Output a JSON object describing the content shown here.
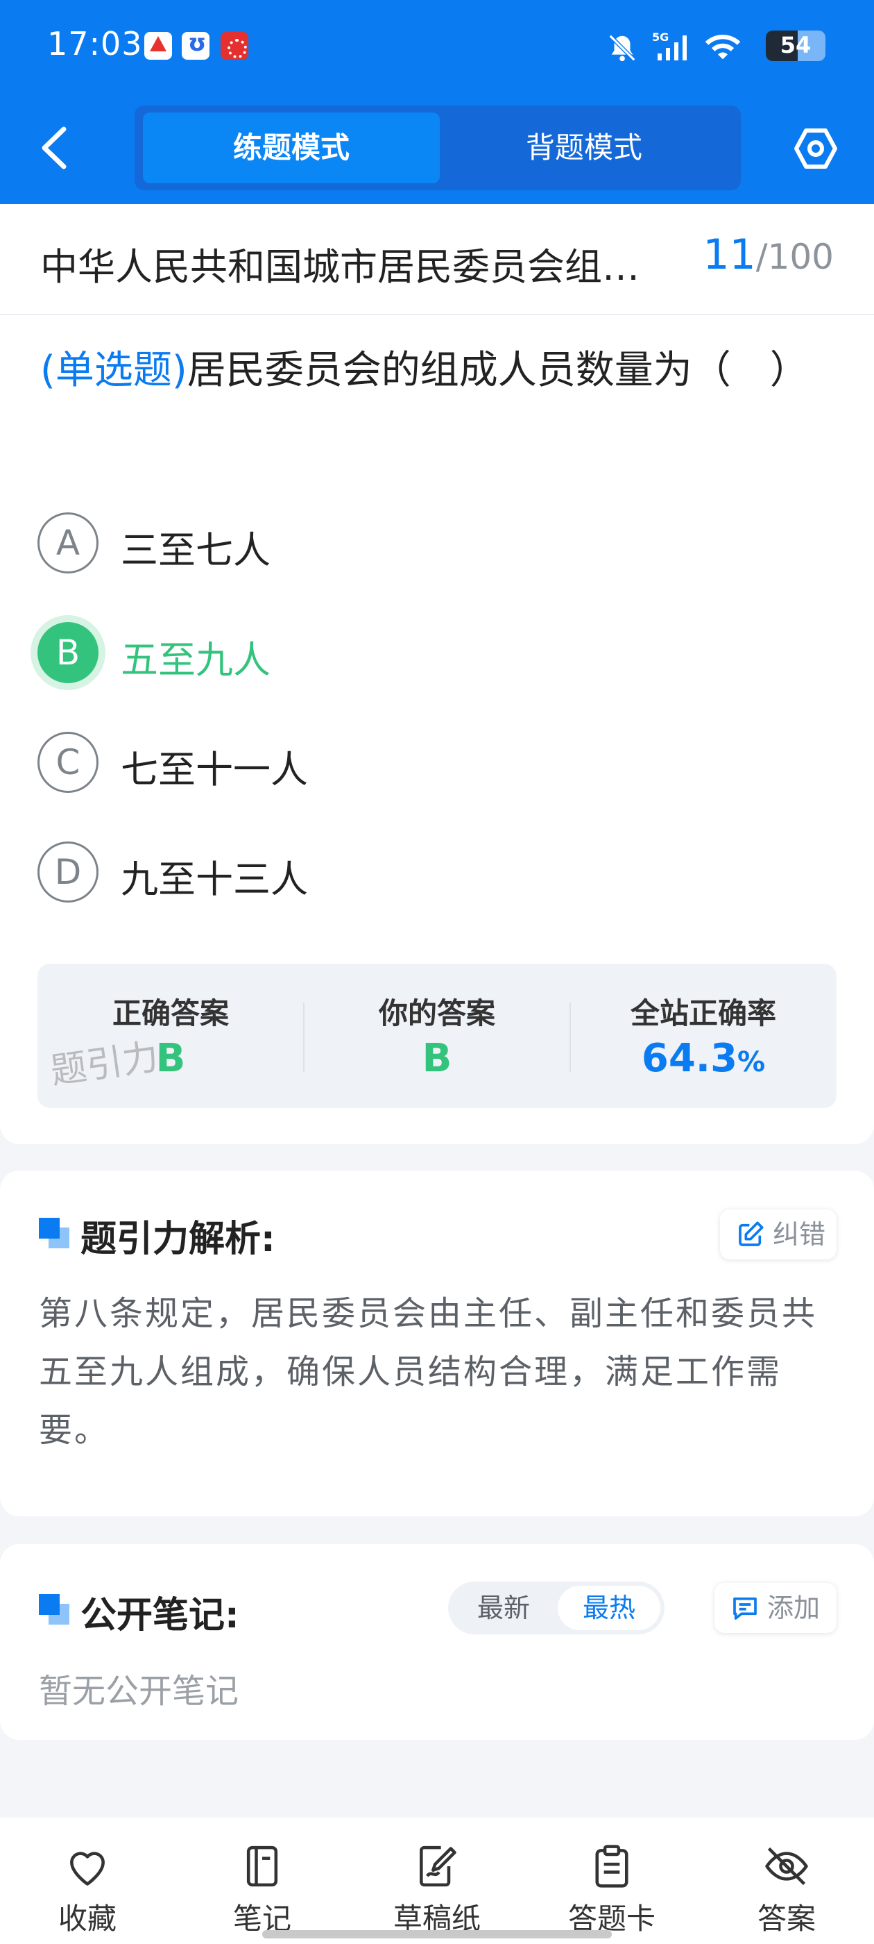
{
  "status_bar": {
    "time": "17:03",
    "battery": "54",
    "battery_level": 0.54,
    "icons": [
      "app-icon-red",
      "app-icon-blue",
      "app-icon-jigsaw",
      "bell-off-icon",
      "signal-5g-icon",
      "wifi-icon",
      "battery-icon"
    ]
  },
  "header": {
    "tabs": [
      {
        "label": "练题模式",
        "active": true
      },
      {
        "label": "背题模式",
        "active": false
      }
    ]
  },
  "title_row": {
    "title": "中华人民共和国城市居民委员会组…",
    "current": "11",
    "separator": "/",
    "total": "100"
  },
  "question": {
    "type": "(单选题)",
    "text": "居民委员会的组成人员数量为（　）",
    "options": [
      {
        "letter": "A",
        "text": "三至七人",
        "state": "normal"
      },
      {
        "letter": "B",
        "text": "五至九人",
        "state": "correct"
      },
      {
        "letter": "C",
        "text": "七至十一人",
        "state": "normal"
      },
      {
        "letter": "D",
        "text": "九至十三人",
        "state": "normal"
      }
    ]
  },
  "stats": {
    "correct_label": "正确答案",
    "correct_value": "B",
    "yours_label": "你的答案",
    "yours_value": "B",
    "rate_label": "全站正确率",
    "rate_value": "64.3",
    "rate_unit": "%",
    "watermark": "题引力"
  },
  "analysis": {
    "title": "题引力解析:",
    "report_label": "纠错",
    "text": "第八条规定，居民委员会由主任、副主任和委员共五至九人组成，确保人员结构合理，满足工作需要。"
  },
  "notes": {
    "title": "公开笔记:",
    "sort_newest": "最新",
    "sort_hot": "最热",
    "add_label": "添加",
    "empty_text": "暂无公开笔记"
  },
  "bottom_nav": [
    {
      "label": "收藏",
      "icon": "heart-icon"
    },
    {
      "label": "笔记",
      "icon": "notebook-icon"
    },
    {
      "label": "草稿纸",
      "icon": "draft-icon"
    },
    {
      "label": "答题卡",
      "icon": "answer-card-icon"
    },
    {
      "label": "答案",
      "icon": "eye-off-icon"
    }
  ],
  "colors": {
    "brand": "#0a7bf0",
    "correct": "#33c37c",
    "background": "#f3f5f8"
  }
}
